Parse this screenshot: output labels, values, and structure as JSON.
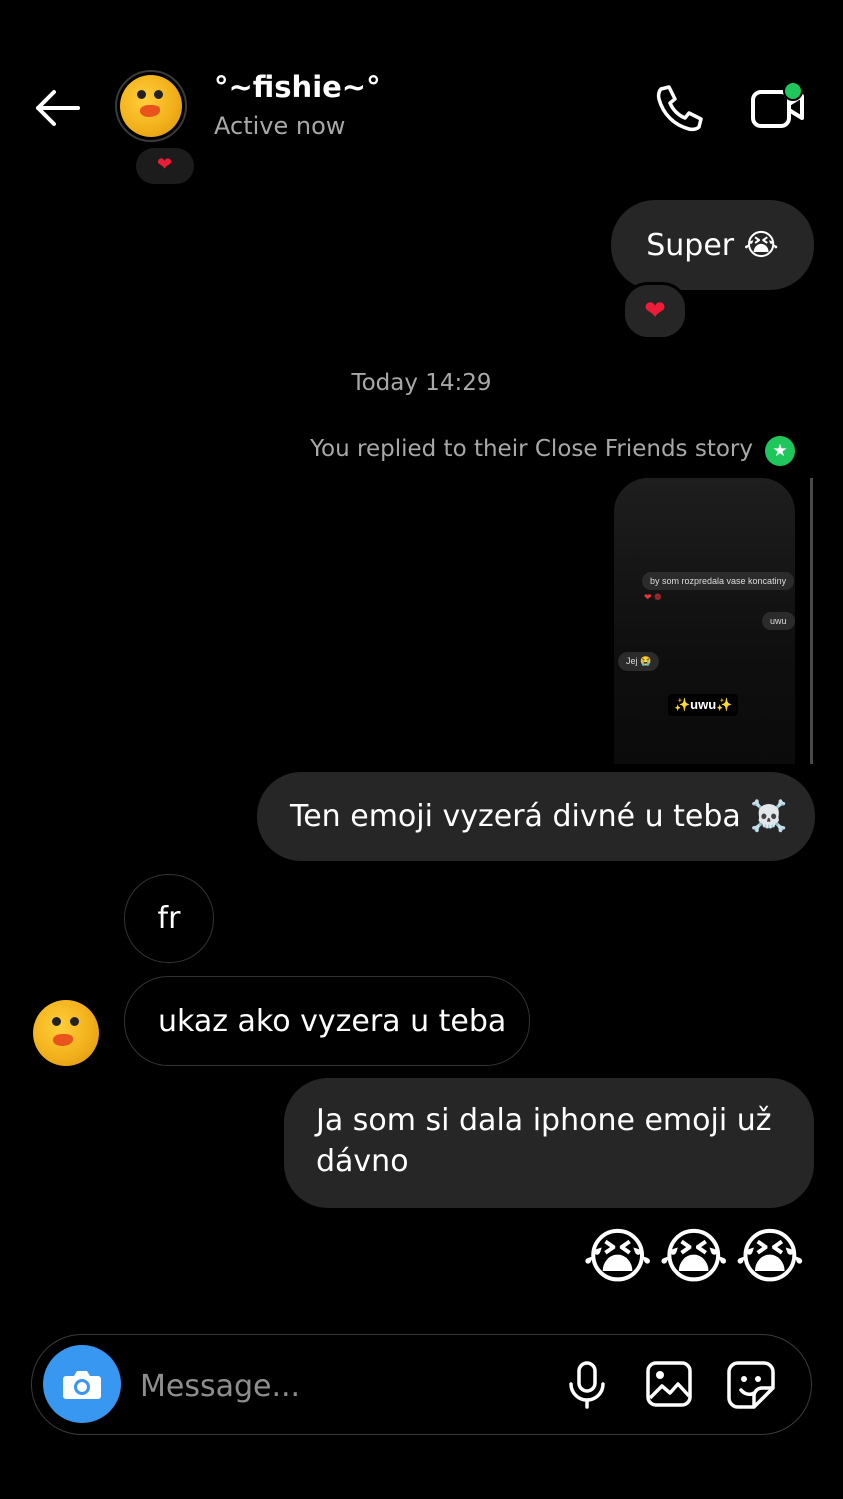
{
  "header": {
    "title": "°~fishie~°",
    "status": "Active now",
    "back_icon": "arrow-left-icon",
    "call_icon": "phone-icon",
    "video_icon": "video-camera-icon",
    "online_dot_color": "#1fc65b"
  },
  "messages": {
    "super": "Super 😭",
    "super_reaction": "❤",
    "timestamp": "Today 14:29",
    "story_note": "You replied to their Close Friends story",
    "story_preview": {
      "line1": "by som rozpredala vase koncatiny",
      "reactions": "❤ ❁",
      "line2": "uwu",
      "line3": "Jej 😭",
      "caption": "✨uwu✨"
    },
    "emoji_msg": "Ten emoji vyzerá divné u teba ☠️",
    "fr": "fr",
    "ukaz": "ukaz ako vyzera u teba",
    "ja": "Ja som si dala iphone emoji už dávno",
    "big_emoji": "😭😭😭"
  },
  "composer": {
    "placeholder": "Message...",
    "camera_color": "#3897f0",
    "icons": [
      "camera-icon",
      "microphone-icon",
      "gallery-icon",
      "sticker-icon"
    ]
  },
  "colors": {
    "bubble_outgoing": "#262626",
    "close_friends_star": "#1fc65b"
  }
}
